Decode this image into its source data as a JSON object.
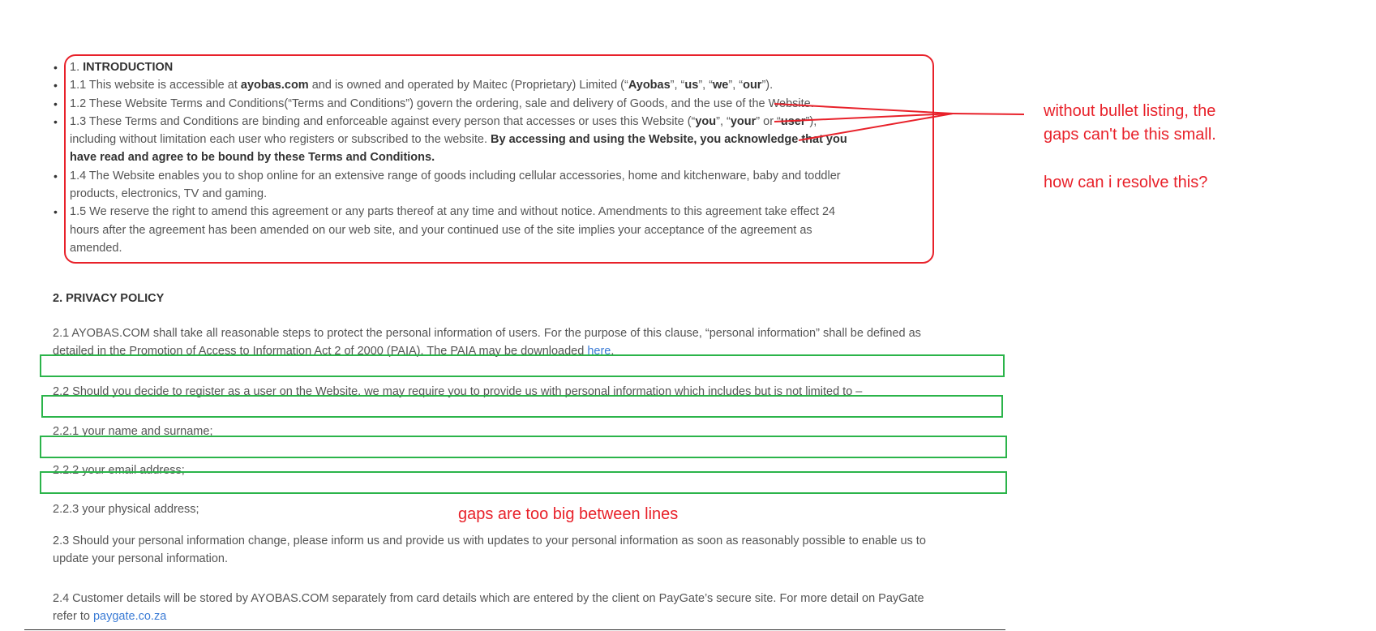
{
  "section1": {
    "items": [
      {
        "parts": [
          {
            "t": "1.  "
          },
          {
            "t": "INTRODUCTION",
            "b": true
          }
        ]
      },
      {
        "parts": [
          {
            "t": "1.1  This website is accessible at "
          },
          {
            "t": "ayobas.com",
            "b": true
          },
          {
            "t": " and is owned and operated by Maitec (Proprietary) Limited (“"
          },
          {
            "t": "Ayobas",
            "b": true
          },
          {
            "t": "”, “"
          },
          {
            "t": "us",
            "b": true
          },
          {
            "t": "”, “"
          },
          {
            "t": "we",
            "b": true
          },
          {
            "t": "”, “"
          },
          {
            "t": "our",
            "b": true
          },
          {
            "t": "”)."
          }
        ]
      },
      {
        "parts": [
          {
            "t": "1.2  These Website Terms and Conditions(“Terms and Conditions”) govern the ordering, sale and delivery of Goods, and the use of the Website."
          }
        ]
      },
      {
        "parts": [
          {
            "t": "1.3  These Terms and Conditions are binding and enforceable against every person that accesses or uses this Website (“"
          },
          {
            "t": "you",
            "b": true
          },
          {
            "t": "”, “"
          },
          {
            "t": "your",
            "b": true
          },
          {
            "t": "” or “"
          },
          {
            "t": "user",
            "b": true
          },
          {
            "t": "”), including without limitation each user who registers or subscribed to the website. "
          },
          {
            "t": "By accessing and using the Website, you acknowledge that you have read and agree to be bound by these Terms and Conditions.",
            "b": true
          }
        ]
      },
      {
        "parts": [
          {
            "t": "1.4  The Website enables you to shop online for an extensive range of goods including cellular accessories, home and kitchenware, baby and toddler products, electronics, TV and gaming."
          }
        ]
      },
      {
        "parts": [
          {
            "t": "1.5  We reserve the right to amend this agreement or any parts thereof at any time and without notice. Amendments to this agreement take effect 24 hours after the agreement has been amended on our web site, and your continued use of the site implies your acceptance of the agreement as amended."
          }
        ]
      }
    ]
  },
  "section2": {
    "heading": "2.  PRIVACY POLICY",
    "p21": "2.1  AYOBAS.COM shall take all reasonable steps to protect the personal information of users. For the purpose of this clause, “personal information” shall be defined as detailed in the Promotion of Access to Information Act 2 of 2000 (PAIA). The PAIA may be downloaded ",
    "p21_link": "here",
    "p21_end": ".",
    "p22": "2.2  Should you decide to register as a user on the Website, we may require you to provide us with personal information which includes but is not limited to –",
    "p221": "2.2.1  your name and surname;",
    "p222": "2.2.2  your email address;",
    "p223": "2.2.3  your physical address;",
    "p23": "2.3  Should your personal information change, please inform us and provide us with updates to your personal information as soon as reasonably possible to enable us to update your personal information.",
    "p24": "2.4  Customer details will be stored by AYOBAS.COM separately from card details which are entered by the client on PayGate’s secure site.  For more detail on PayGate refer to ",
    "p24_link": "paygate.co.za"
  },
  "annotations": {
    "red_line1": "without bullet listing, the",
    "red_line2": "gaps can't be this small.",
    "red_question": "how can i resolve this?",
    "green_note": "gaps are too big between lines"
  },
  "colors": {
    "annotation_red": "#e8212a",
    "annotation_green": "#2bb44a",
    "link": "#3a7bd5"
  }
}
